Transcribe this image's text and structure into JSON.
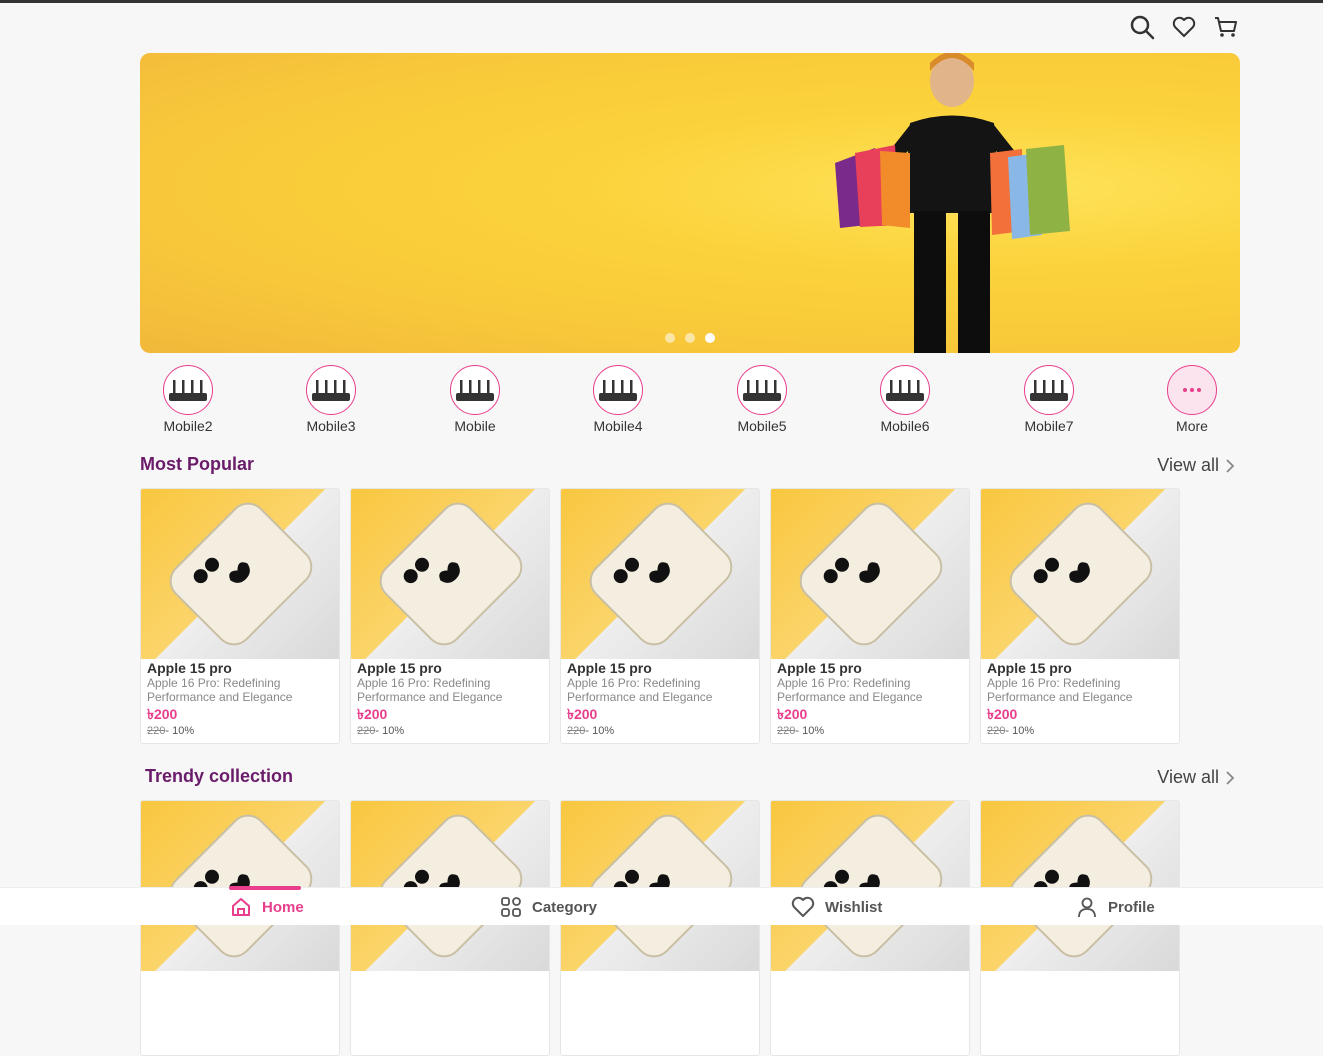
{
  "header": {
    "icons": [
      "search-icon",
      "heart-icon",
      "cart-icon"
    ]
  },
  "banner": {
    "slides": 3,
    "active_slide": 3,
    "colors": {
      "primary": "#fbd23b"
    }
  },
  "categories": [
    {
      "label": "Mobile2"
    },
    {
      "label": "Mobile3"
    },
    {
      "label": "Mobile"
    },
    {
      "label": "Mobile4"
    },
    {
      "label": "Mobile5"
    },
    {
      "label": "Mobile6"
    },
    {
      "label": "Mobile7"
    },
    {
      "label": "More"
    }
  ],
  "most_popular": {
    "title": "Most Popular",
    "view_all": "View all",
    "products": [
      {
        "name": "Apple 15 pro",
        "desc": "Apple 16 Pro: Redefining Performance and Elegance",
        "price": "৳200",
        "old_price": "220",
        "discount": "- 10%"
      },
      {
        "name": "Apple 15 pro",
        "desc": "Apple 16 Pro: Redefining Performance and Elegance",
        "price": "৳200",
        "old_price": "220",
        "discount": "- 10%"
      },
      {
        "name": "Apple 15 pro",
        "desc": "Apple 16 Pro: Redefining Performance and Elegance",
        "price": "৳200",
        "old_price": "220",
        "discount": "- 10%"
      },
      {
        "name": "Apple 15 pro",
        "desc": "Apple 16 Pro: Redefining Performance and Elegance",
        "price": "৳200",
        "old_price": "220",
        "discount": "- 10%"
      },
      {
        "name": "Apple 15 pro",
        "desc": "Apple 16 Pro: Redefining Performance and Elegance",
        "price": "৳200",
        "old_price": "220",
        "discount": "- 10%"
      }
    ]
  },
  "trendy": {
    "title": "Trendy collection",
    "view_all": "View all"
  },
  "bottom_nav": {
    "home": "Home",
    "category": "Category",
    "wishlist": "Wishlist",
    "profile": "Profile",
    "accent": "#e83e8c"
  }
}
